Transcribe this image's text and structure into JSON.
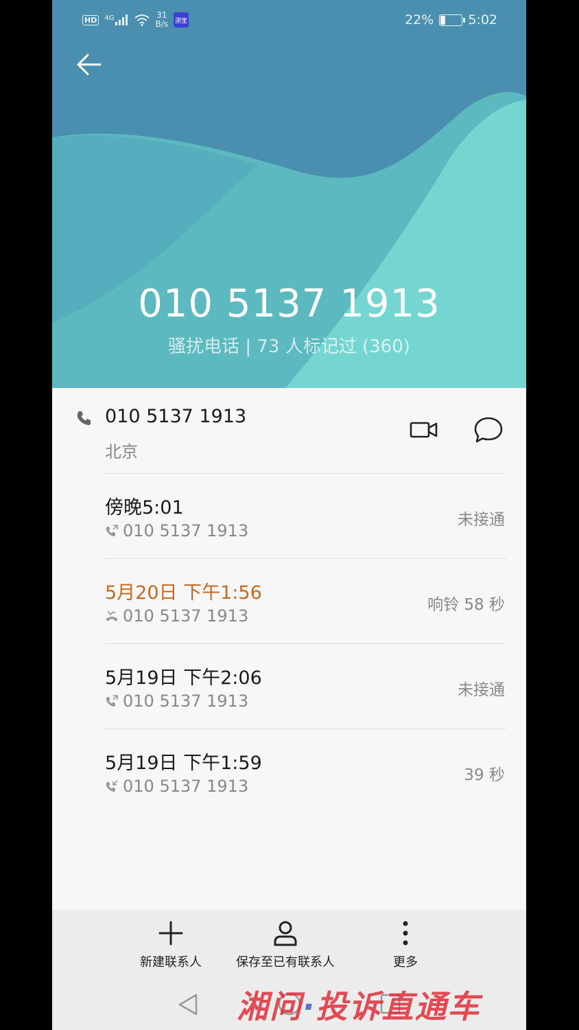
{
  "status_bar": {
    "hd": "HD",
    "network": "4G",
    "speed_top": "31",
    "speed_bottom": "B/s",
    "app_badge": "测宝",
    "battery_percent": "22%",
    "battery_level": 0.22,
    "time": "5:02"
  },
  "header": {
    "phone_number": "010 5137 1913",
    "tag_line": "骚扰电话 | 73 人标记过 (360)",
    "colors": {
      "deep": "#4a8eb0",
      "teal": "#5fc4c0",
      "light": "#7de3d6"
    }
  },
  "number_row": {
    "number": "010 5137 1913",
    "location": "北京"
  },
  "calls": [
    {
      "time": "傍晚5:01",
      "number": "010 5137 1913",
      "status": "未接通",
      "type": "outgoing",
      "missed": false
    },
    {
      "time": "5月20日 下午1:56",
      "number": "010 5137 1913",
      "status": "响铃 58 秒",
      "type": "missed",
      "missed": true
    },
    {
      "time": "5月19日 下午2:06",
      "number": "010 5137 1913",
      "status": "未接通",
      "type": "outgoing",
      "missed": false
    },
    {
      "time": "5月19日 下午1:59",
      "number": "010 5137 1913",
      "status": "39 秒",
      "type": "incoming",
      "missed": false
    }
  ],
  "toolbar": {
    "new_contact": "新建联系人",
    "save_existing": "保存至已有联系人",
    "more": "更多"
  },
  "watermark": {
    "part1": "湘问",
    "sep": "·",
    "part2": "投诉直通车"
  },
  "colors": {
    "missed": "#c9691e"
  }
}
